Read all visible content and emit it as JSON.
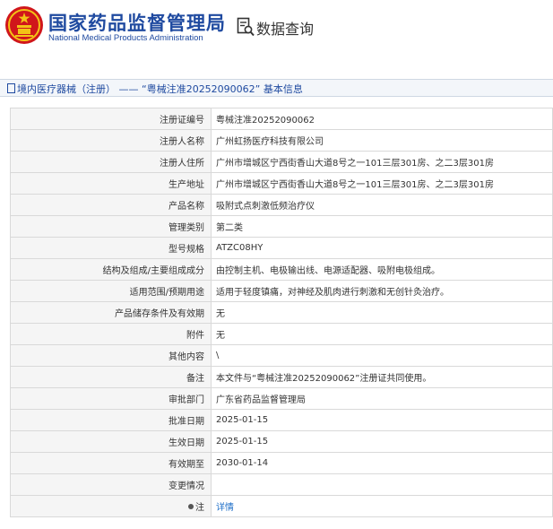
{
  "header": {
    "title": "国家药品监督管理局",
    "subtitle": "National Medical Products Administration",
    "query_label": "数据查询"
  },
  "breadcrumb": {
    "text": "境内医疗器械（注册） —— “粤械注准20252090062” 基本信息"
  },
  "rows": [
    {
      "label": "注册证编号",
      "value": "粤械注准20252090062"
    },
    {
      "label": "注册人名称",
      "value": "广州虹扬医疗科技有限公司"
    },
    {
      "label": "注册人住所",
      "value": "广州市增城区宁西街香山大道8号之一101三层301房、之二3层301房"
    },
    {
      "label": "生产地址",
      "value": "广州市增城区宁西街香山大道8号之一101三层301房、之二3层301房"
    },
    {
      "label": "产品名称",
      "value": "吸附式点刺激低频治疗仪"
    },
    {
      "label": "管理类别",
      "value": "第二类"
    },
    {
      "label": "型号规格",
      "value": "ATZC08HY"
    },
    {
      "label": "结构及组成/主要组成成分",
      "value": "由控制主机、电极输出线、电源适配器、吸附电极组成。"
    },
    {
      "label": "适用范围/预期用途",
      "value": "适用于轻度镇痛，对神经及肌肉进行刺激和无创针灸治疗。"
    },
    {
      "label": "产品储存条件及有效期",
      "value": "无"
    },
    {
      "label": "附件",
      "value": "无"
    },
    {
      "label": "其他内容",
      "value": "\\"
    },
    {
      "label": "备注",
      "value": "本文件与“粤械注准20252090062”注册证共同使用。"
    },
    {
      "label": "审批部门",
      "value": "广东省药品监督管理局"
    },
    {
      "label": "批准日期",
      "value": "2025-01-15"
    },
    {
      "label": "生效日期",
      "value": "2025-01-15"
    },
    {
      "label": "有效期至",
      "value": "2030-01-14"
    },
    {
      "label": "变更情况",
      "value": ""
    },
    {
      "label": "注",
      "value": "详情"
    }
  ],
  "colors": {
    "brand_blue": "#1f4aa0",
    "link_blue": "#1f6fc8",
    "emblem_red": "#d0161b",
    "emblem_gold": "#f3c316"
  },
  "icons": {
    "emblem": "national-emblem",
    "query": "search-document-icon",
    "breadcrumb": "document-icon",
    "note": "bullet-icon"
  }
}
